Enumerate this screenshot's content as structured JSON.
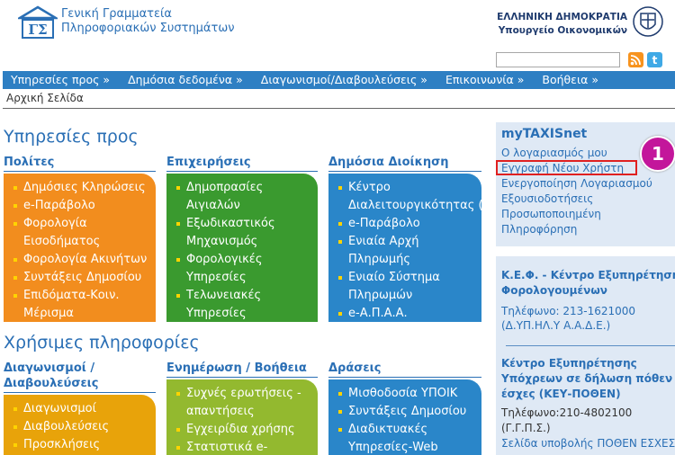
{
  "header": {
    "org_line1": "Γενική Γραμματεία",
    "org_line2": "Πληροφοριακών Συστημάτων",
    "gov_line1": "ΕΛΛΗΝΙΚΗ ΔΗΜΟΚΡΑΤΙΑ",
    "gov_line2": "Υπουργείο Οικονομικών",
    "search_value": "",
    "icons": {
      "logo": "gsis-logo-icon",
      "emblem": "greek-emblem-icon",
      "rss": "rss-icon",
      "twitter": "twitter-icon"
    }
  },
  "nav": {
    "items": [
      "Υπηρεσίες προς »",
      "Δημόσια δεδομένα »",
      "Διαγωνισμοί/Διαβουλεύσεις »",
      "Επικοινωνία »",
      "Βοήθεια »"
    ]
  },
  "breadcrumb": "Αρχική Σελίδα",
  "services": {
    "title": "Υπηρεσίες προς",
    "columns": [
      {
        "heading": "Πολίτες",
        "items": [
          "Δημόσιες Κληρώσεις",
          "e-Παράβολο",
          "Φορολογία",
          "Εισοδήματος",
          "Φορολογία Ακινήτων",
          "Συντάξεις Δημοσίου",
          "Επιδόματα-Κοιν.",
          "Μέρισμα"
        ]
      },
      {
        "heading": "Επιχειρήσεις",
        "items": [
          "Δημοπρασίες",
          "Αιγιαλών",
          "Εξωδικαστικός",
          "Μηχανισμός",
          "Φορολογικές",
          "Υπηρεσίες",
          "Τελωνειακές",
          "Υπηρεσίες"
        ]
      },
      {
        "heading": "Δημόσια Διοίκηση",
        "items": [
          "Κέντρο",
          "Διαλειτουργικότητας (Κ",
          "e-Παράβολο",
          "Ενιαία Αρχή",
          "Πληρωμής",
          "Ενιαίο Σύστημα",
          "Πληρωμών",
          "e-Α.Π.Α.Α."
        ]
      }
    ]
  },
  "useful": {
    "title": "Χρήσιμες πληροφορίες",
    "columns": [
      {
        "heading_line1": "Διαγωνισμοί /",
        "heading_line2": "Διαβουλεύσεις",
        "items": [
          "Διαγωνισμοί",
          "Διαβουλεύσεις",
          "Προσκλήσεις"
        ]
      },
      {
        "heading_line1": "Ενημέρωση / Βοήθεια",
        "heading_line2": "",
        "items": [
          "Συχνές ερωτήσεις -",
          "απαντήσεις",
          "Εγχειρίδια χρήσης",
          "Στατιστικά e-"
        ]
      },
      {
        "heading_line1": "Δράσεις",
        "heading_line2": "",
        "items": [
          "Μισθοδοσία ΥΠΟΙΚ",
          "Συντάξεις Δημοσίου",
          "Διαδικτυακές",
          "Υπηρεσίες-Web"
        ]
      }
    ]
  },
  "sidebar": {
    "title": "myTAXISnet",
    "links": [
      "Ο λογαριασμός μου",
      "Εγγραφή Νέου Χρήστη",
      "Ενεργοποίηση Λογαριασμού",
      "Εξουσιοδοτήσεις",
      "Προσωποποιημένη",
      "Πληροφόρηση"
    ],
    "kef_title1": "Κ.Ε.Φ. - Κέντρο Εξυπηρέτησης",
    "kef_title2": "Φορολογουμένων",
    "kef_phone": "Τηλέφωνο: 213-1621000",
    "kef_org": "(Δ.ΥΠ.ΗΛ.Υ Α.Α.Δ.Ε.)",
    "poth_title1": "Κέντρο Εξυπηρέτησης",
    "poth_title2": "Υπόχρεων σε δήλωση πόθεν",
    "poth_title3": "έσχες (ΚΕΥ-ΠΟΘΕΝ)",
    "poth_phone": "Τηλέφωνο:210-4802100",
    "poth_org": "(Γ.Γ.Π.Σ.)",
    "poth_link": "Σελίδα υποβολής ΠΟΘΕΝ ΕΣΧΕΣ"
  },
  "annotation": {
    "step": "1"
  },
  "colors": {
    "nav": "#2e7fc3",
    "orange": "#f28d1e",
    "green": "#3a9a2f",
    "blue": "#2a86c9",
    "yellow": "#e8a30a",
    "lime": "#93b92f",
    "sidebar": "#dfe9f5",
    "badge": "#c3169b",
    "highlight": "#e02020"
  }
}
